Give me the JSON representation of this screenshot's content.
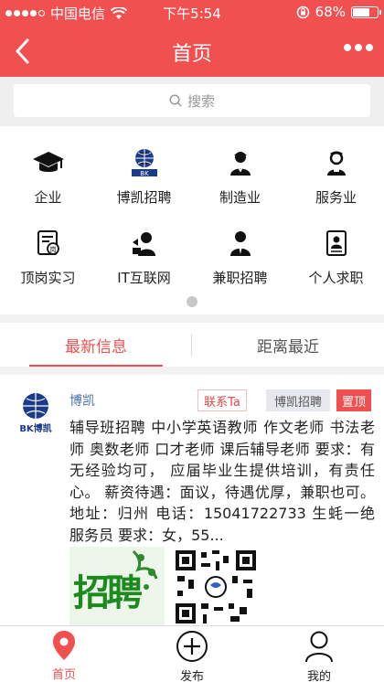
{
  "status_bar": {
    "carrier": "中国电信",
    "time": "下午5:54",
    "battery": "68%",
    "battery_level": 0.68
  },
  "nav": {
    "title": "首页",
    "back_icon": "chevron-left-icon",
    "more_icon": "more-dots-icon"
  },
  "search": {
    "placeholder": "搜索"
  },
  "categories": [
    {
      "label": "企业",
      "icon": "graduation-cap-icon"
    },
    {
      "label": "博凯招聘",
      "icon": "bokai-logo-icon"
    },
    {
      "label": "制造业",
      "icon": "worker-icon"
    },
    {
      "label": "服务业",
      "icon": "service-person-icon"
    },
    {
      "label": "顶岗实习",
      "icon": "internship-doc-icon"
    },
    {
      "label": "IT互联网",
      "icon": "it-person-icon"
    },
    {
      "label": "兼职招聘",
      "icon": "suit-person-icon"
    },
    {
      "label": "个人求职",
      "icon": "resume-icon"
    }
  ],
  "tabs": {
    "latest": "最新信息",
    "nearest": "距离最近"
  },
  "post": {
    "author": "博凯",
    "avatar_text": "BK博凯",
    "contact_label": "联系Ta",
    "category_label": "博凯招聘",
    "pinned_label": "置顶",
    "content": "辅导班招聘 中小学英语教师 作文老师 书法老师 奥数老师 口才老师 课后辅导老师 要求：有无经验均可， 应届毕业生提供培训，有责任心。 薪资待遇：面议，待遇优厚，兼职也可。 地址：归州 电话：15041722733 生蚝一绝  服务员 要求：女，55...",
    "recruit_image_text": "招聘"
  },
  "bottom_nav": {
    "home": "首页",
    "publish": "发布",
    "mine": "我的"
  },
  "colors": {
    "brand": "#f05050",
    "link": "#4a6fa5"
  }
}
